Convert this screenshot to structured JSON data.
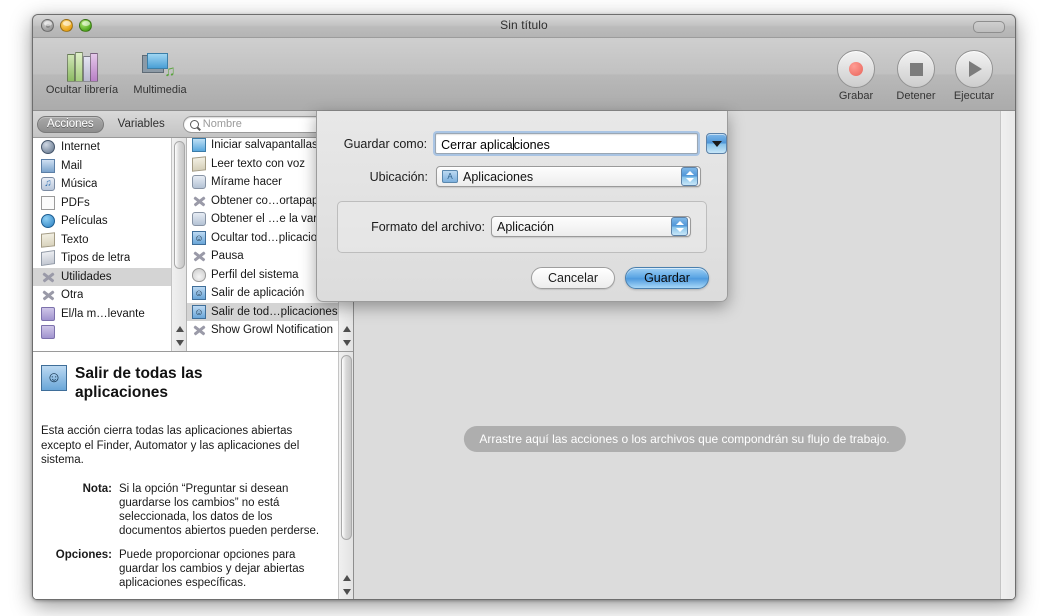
{
  "window": {
    "title": "Sin título",
    "traffic": [
      "close-button",
      "minimize-button",
      "zoom-button"
    ]
  },
  "toolbar": {
    "items": [
      {
        "label": "Ocultar librería",
        "icon": "library-icon"
      },
      {
        "label": "Multimedia",
        "icon": "media-icon"
      }
    ],
    "right_items": [
      {
        "label": "Grabar",
        "icon": "record-icon"
      },
      {
        "label": "Detener",
        "icon": "stop-icon"
      },
      {
        "label": "Ejecutar",
        "icon": "play-icon"
      }
    ]
  },
  "library": {
    "tabs": [
      {
        "label": "Acciones",
        "active": true
      },
      {
        "label": "Variables",
        "active": false
      }
    ],
    "search": {
      "placeholder": "Nombre",
      "value": "",
      "icon": "search-icon"
    },
    "categories": [
      {
        "label": "Internet",
        "icon": "globe-icon",
        "selected": false
      },
      {
        "label": "Mail",
        "icon": "mail-icon",
        "selected": false
      },
      {
        "label": "Música",
        "icon": "music-icon",
        "selected": false
      },
      {
        "label": "PDFs",
        "icon": "pdf-icon",
        "selected": false
      },
      {
        "label": "Películas",
        "icon": "movie-icon",
        "selected": false
      },
      {
        "label": "Texto",
        "icon": "text-icon",
        "selected": false
      },
      {
        "label": "Tipos de letra",
        "icon": "font-icon",
        "selected": false
      },
      {
        "label": "Utilidades",
        "icon": "utility-icon",
        "selected": true
      },
      {
        "label": "Otra",
        "icon": "utility-icon",
        "selected": false
      },
      {
        "label": "El/la m…levante",
        "icon": "folder-icon",
        "selected": false
      }
    ],
    "actions": [
      {
        "label": "Iniciar salvapantallas",
        "icon": "screensaver-icon",
        "selected": false
      },
      {
        "label": "Leer texto con voz",
        "icon": "speak-icon",
        "selected": false
      },
      {
        "label": "Mírame hacer",
        "icon": "watchme-icon",
        "selected": false
      },
      {
        "label": "Obtener co…ortapap",
        "icon": "utility-icon",
        "selected": false
      },
      {
        "label": "Obtener el …e la var",
        "icon": "watchme-icon",
        "selected": false
      },
      {
        "label": "Ocultar tod…plicacio",
        "icon": "finder-icon",
        "selected": false
      },
      {
        "label": "Pausa",
        "icon": "utility-icon",
        "selected": false
      },
      {
        "label": "Perfil del sistema",
        "icon": "profile-icon",
        "selected": false
      },
      {
        "label": "Salir de aplicación",
        "icon": "finder-icon",
        "selected": false
      },
      {
        "label": "Salir de tod…plicaciones",
        "icon": "finder-icon",
        "selected": true
      },
      {
        "label": "Show Growl Notification",
        "icon": "utility-icon",
        "selected": false
      }
    ]
  },
  "description": {
    "icon": "finder-icon",
    "title": "Salir de todas las aplicaciones",
    "body": "Esta acción cierra todas las aplicaciones abiertas excepto el Finder, Automator y las aplicaciones del sistema.",
    "fields": [
      {
        "key": "Nota:",
        "value": "Si la opción “Preguntar si desean guardarse los cambios” no está seleccionada, los datos de los documentos abiertos pueden perderse."
      },
      {
        "key": "Opciones:",
        "value": "Puede proporcionar opciones para guardar los cambios y dejar abiertas aplicaciones específicas."
      }
    ]
  },
  "workflow": {
    "placeholder": "Arrastre aquí las acciones o los archivos que compondrán su flujo de trabajo."
  },
  "bottombar": {
    "gear_label": "",
    "buttons": [
      {
        "name": "action-menu-button",
        "icon": "gear-icon"
      },
      {
        "name": "disclosure-button",
        "icon": "box-triangle-icon"
      }
    ],
    "view_buttons": [
      {
        "name": "list-view-button",
        "icon": "list-icon"
      },
      {
        "name": "stack-view-button",
        "icon": "stack-icon"
      }
    ]
  },
  "save_sheet": {
    "name_label": "Guardar como:",
    "name_value": "Cerrar aplicaciones",
    "disclosure_icon": "chevron-down-icon",
    "location_label": "Ubicación:",
    "location_value": "Aplicaciones",
    "location_icon": "applications-folder-icon",
    "format_label": "Formato del archivo:",
    "format_value": "Aplicación",
    "cancel_label": "Cancelar",
    "save_label": "Guardar"
  },
  "colors": {
    "accent": "#4e95d8",
    "selection": "#d4d4d4",
    "window_bg": "#dcdcdc",
    "placeholder": "#aeaeae"
  }
}
